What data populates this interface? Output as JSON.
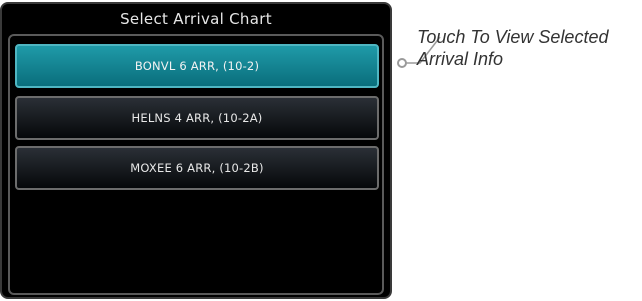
{
  "panel": {
    "title": "Select Arrival Chart",
    "items": [
      {
        "label": "BONVL 6 ARR, (10-2)",
        "selected": true
      },
      {
        "label": "HELNS 4 ARR, (10-2A)",
        "selected": false
      },
      {
        "label": "MOXEE 6 ARR, (10-2B)",
        "selected": false
      }
    ]
  },
  "callout": {
    "line1": "Touch To View Selected",
    "line2": "Arrival Info"
  },
  "colors": {
    "selected": "#168796",
    "panel_bg": "#000000",
    "callout_text": "#333333"
  }
}
